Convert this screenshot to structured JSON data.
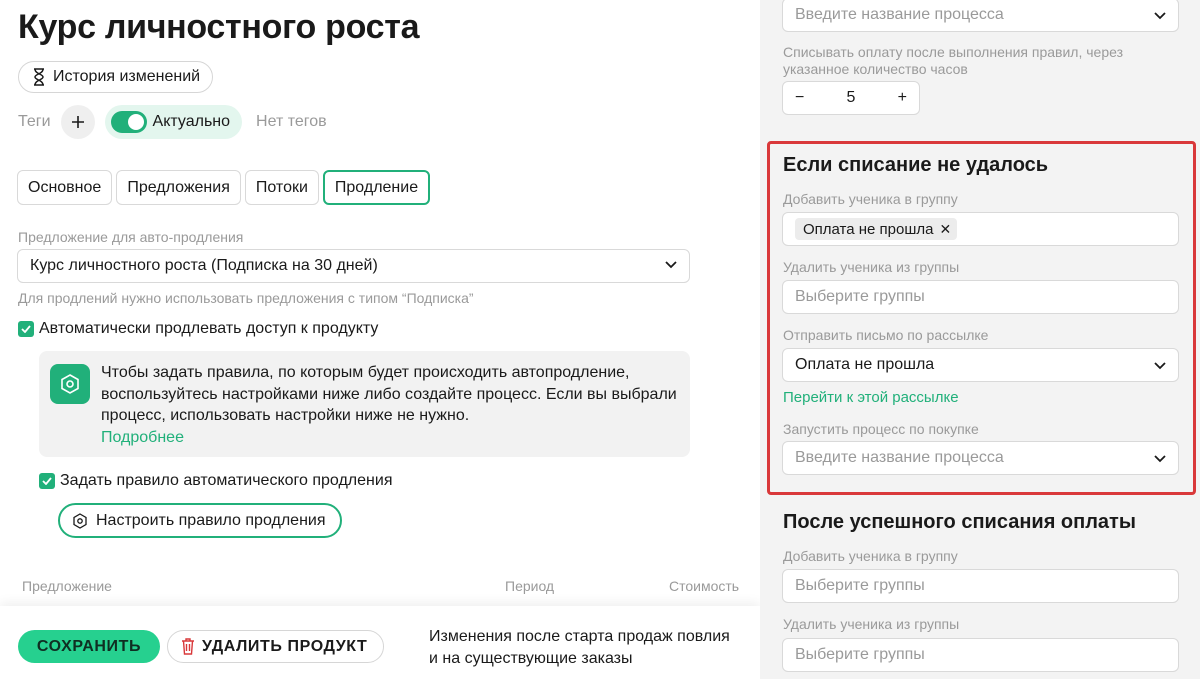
{
  "page": {
    "title": "Курс личностного роста",
    "history_label": "История изменений",
    "tags_label": "Теги",
    "status_label": "Актуально",
    "no_tags": "Нет тегов"
  },
  "tabs": [
    {
      "label": "Основное",
      "active": false
    },
    {
      "label": "Предложения",
      "active": false
    },
    {
      "label": "Потоки",
      "active": false
    },
    {
      "label": "Продление",
      "active": true
    }
  ],
  "renewal": {
    "offer_label": "Предложение для авто-продления",
    "offer_value": "Курс личностного роста (Подписка на 30 дней)",
    "offer_hint": "Для продлений нужно использовать предложения с типом “Подписка”",
    "auto_renew_label": "Автоматически продлевать доступ к продукту",
    "auto_renew_checked": true,
    "info_text": "Чтобы задать правила, по которым будет происходить автопродление, воспользуйтесь настройками ниже либо создайте процесс. Если вы выбрали процесс, использовать настройки ниже не нужно.",
    "info_link": "Подробнее",
    "set_rule_label": "Задать правило автоматического продления",
    "set_rule_checked": true,
    "configure_rule_button": "Настроить правило продления"
  },
  "table": {
    "headers": [
      "Предложение",
      "Период",
      "Стоимость"
    ]
  },
  "footer": {
    "save_button": "СОХРАНИТЬ",
    "delete_button": "УДАЛИТЬ ПРОДУКТ",
    "note_line1": "Изменения после старта продаж повлия",
    "note_line2": "и на существующие заказы"
  },
  "right_panel": {
    "top_process_placeholder": "Введите название процесса",
    "charge_delay_label": "Списывать оплату после выполнения правил, через указанное количество часов",
    "charge_delay_value": "5",
    "stepper_minus": "−",
    "stepper_plus": "+",
    "failed": {
      "heading": "Если списание не удалось",
      "add_group_label": "Добавить ученика в группу",
      "add_group_chip": "Оплата не прошла",
      "remove_group_label": "Удалить ученика из группы",
      "remove_group_placeholder": "Выберите группы",
      "send_mail_label": "Отправить письмо по рассылке",
      "send_mail_value": "Оплата не прошла",
      "go_to_mailing_link": "Перейти к этой рассылке",
      "run_process_label": "Запустить процесс по покупке",
      "run_process_placeholder": "Введите название процесса"
    },
    "success": {
      "heading": "После успешного списания оплаты",
      "add_group_label": "Добавить ученика в группу",
      "add_group_placeholder": "Выберите группы",
      "remove_group_label": "Удалить ученика из группы",
      "remove_group_placeholder": "Выберите группы"
    }
  },
  "colors": {
    "accent": "#21b07a",
    "save_button": "#26d08f",
    "highlight_border": "#d9383a",
    "right_panel_bg": "#f3f3f3"
  },
  "icons": [
    "hourglass-icon",
    "plus-icon",
    "check-icon",
    "chevron-down-icon",
    "hexagon-icon",
    "trash-icon",
    "close-icon",
    "minus-icon"
  ]
}
